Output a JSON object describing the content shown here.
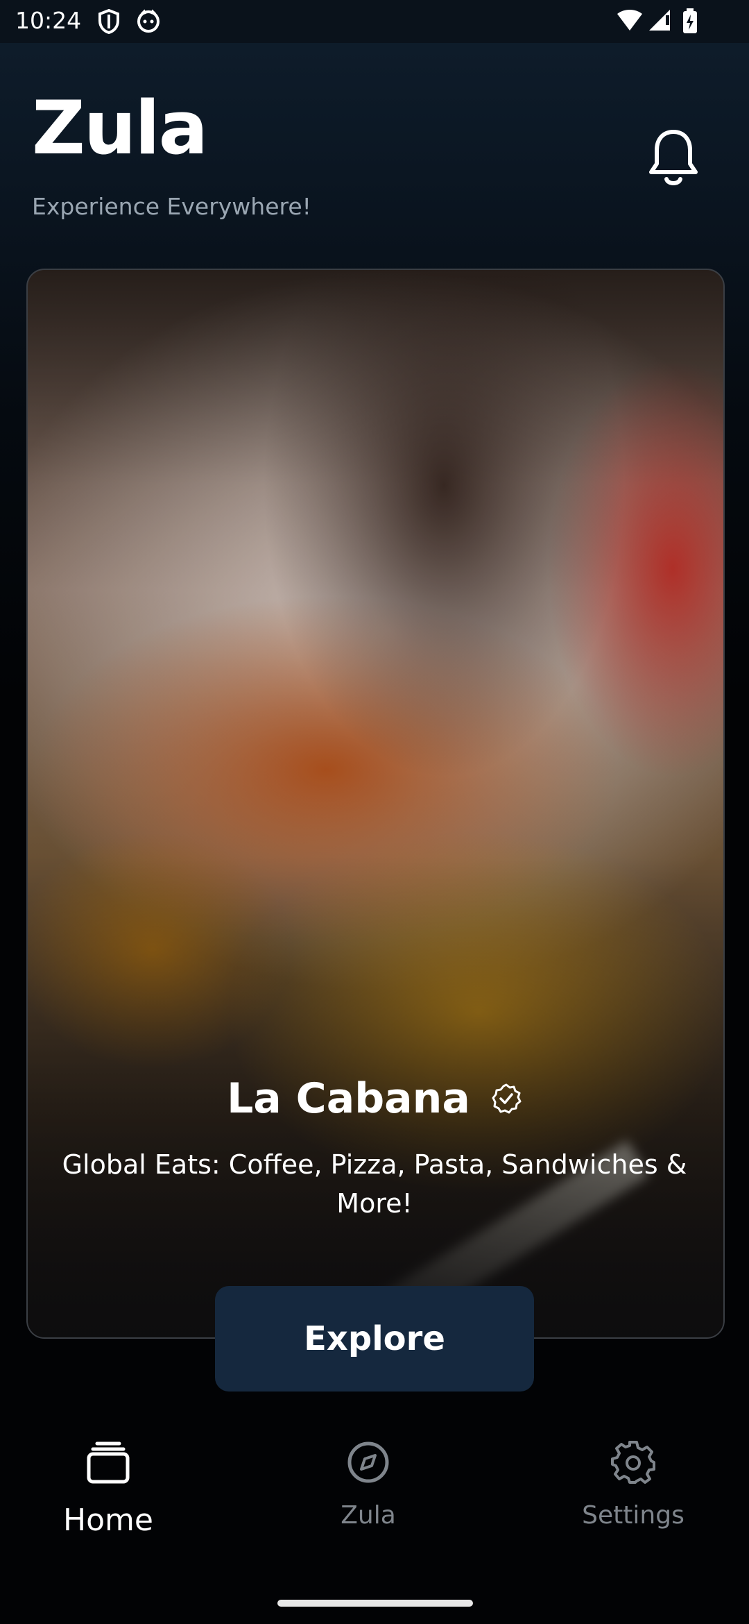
{
  "status_bar": {
    "time": "10:24",
    "icons": [
      "shield-icon",
      "cat-icon",
      "wifi-icon",
      "signal-icon",
      "battery-icon"
    ]
  },
  "header": {
    "logo": "Zula",
    "tagline": "Experience Everywhere!",
    "notification_icon": "bell-icon"
  },
  "hero": {
    "title": "La Cabana",
    "verified_icon": "verified-badge-icon",
    "description": "Global Eats: Coffee, Pizza, Pasta, Sandwiches & More!",
    "button_label": "Explore"
  },
  "nav": {
    "items": [
      {
        "label": "Home",
        "icon": "stack-icon",
        "active": true
      },
      {
        "label": "Zula",
        "icon": "compass-icon",
        "active": false
      },
      {
        "label": "Settings",
        "icon": "gear-icon",
        "active": false
      }
    ]
  },
  "colors": {
    "background": "#020305",
    "button": "#15283e",
    "muted_text": "#7f858c"
  }
}
